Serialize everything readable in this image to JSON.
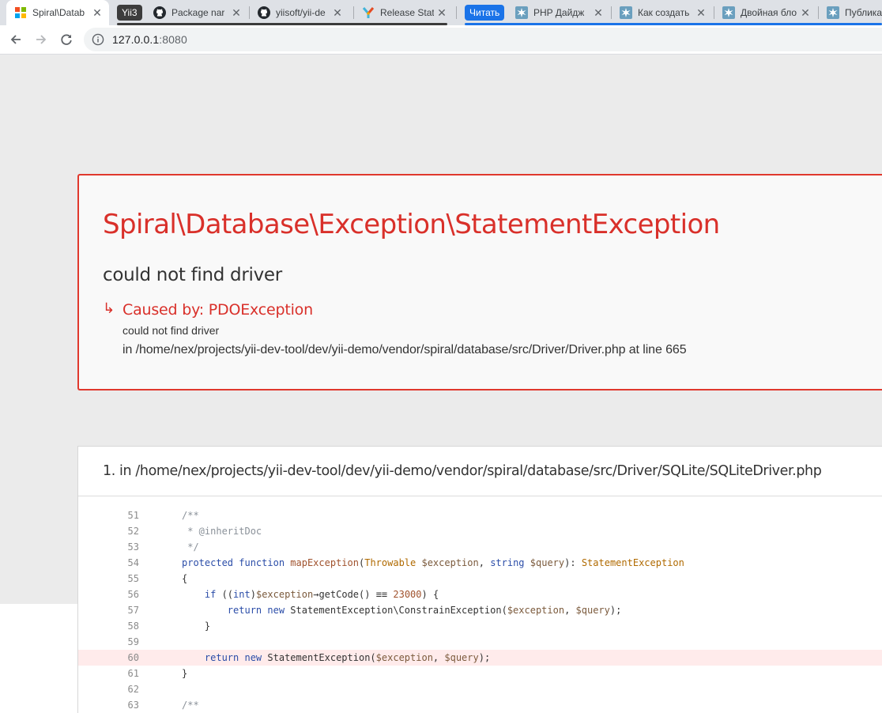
{
  "browser": {
    "tabs": [
      {
        "title": "Spiral\\Datab",
        "icon": "windows-tiles-icon",
        "active": true
      },
      {
        "title": "Package nar",
        "icon": "github-icon",
        "badge": "Yii3",
        "badge_color": "#3c3c3c"
      },
      {
        "title": "yiisoft/yii-de",
        "icon": "github-icon"
      },
      {
        "title": "Release Statu",
        "icon": "yii-logo-icon"
      },
      {
        "title": "PHP Дайдж",
        "icon": "habr-icon",
        "badge": "Читать",
        "badge_color": "#1a73e8"
      },
      {
        "title": "Как создать",
        "icon": "habr-icon"
      },
      {
        "title": "Двойная бло",
        "icon": "habr-icon"
      },
      {
        "title": "Публика",
        "icon": "habr-icon"
      }
    ],
    "address": {
      "host": "127.0.0.1",
      "port": ":8080"
    }
  },
  "exception": {
    "class": "Spiral\\Database\\Exception\\StatementException",
    "message": "could not find driver",
    "cause": {
      "label": "Caused by: PDOException",
      "message": "could not find driver",
      "location": "in /home/nex/projects/yii-dev-tool/dev/yii-demo/vendor/spiral/database/src/Driver/Driver.php at line 665"
    }
  },
  "trace": [
    {
      "title": "1. in /home/nex/projects/yii-dev-tool/dev/yii-demo/vendor/spiral/database/src/Driver/SQLite/SQLiteDriver.php",
      "highlight_line": 60,
      "lines": [
        {
          "n": "51",
          "tokens": [
            [
              "c-comment",
              "/**"
            ]
          ]
        },
        {
          "n": "52",
          "tokens": [
            [
              "c-comment",
              " * @inheritDoc"
            ]
          ]
        },
        {
          "n": "53",
          "tokens": [
            [
              "c-comment",
              " */"
            ]
          ]
        },
        {
          "n": "54",
          "tokens": [
            [
              "c-kw",
              "protected function "
            ],
            [
              "c-fn",
              "mapException"
            ],
            [
              "c-plain",
              "("
            ],
            [
              "c-type",
              "Throwable"
            ],
            [
              "c-plain",
              " "
            ],
            [
              "c-var",
              "$exception"
            ],
            [
              "c-plain",
              ", "
            ],
            [
              "c-kw",
              "string"
            ],
            [
              "c-plain",
              " "
            ],
            [
              "c-var",
              "$query"
            ],
            [
              "c-plain",
              "): "
            ],
            [
              "c-type",
              "StatementException"
            ]
          ]
        },
        {
          "n": "55",
          "tokens": [
            [
              "c-plain",
              "{"
            ]
          ]
        },
        {
          "n": "56",
          "tokens": [
            [
              "c-plain",
              "    "
            ],
            [
              "c-kw",
              "if"
            ],
            [
              "c-plain",
              " (("
            ],
            [
              "c-kw",
              "int"
            ],
            [
              "c-plain",
              ")"
            ],
            [
              "c-var",
              "$exception"
            ],
            [
              "c-plain",
              "→getCode() ≡≡ "
            ],
            [
              "c-num",
              "23000"
            ],
            [
              "c-plain",
              ") {"
            ]
          ]
        },
        {
          "n": "57",
          "tokens": [
            [
              "c-plain",
              "        "
            ],
            [
              "c-kw",
              "return new "
            ],
            [
              "c-plain",
              "StatementException\\ConstrainException("
            ],
            [
              "c-var",
              "$exception"
            ],
            [
              "c-plain",
              ", "
            ],
            [
              "c-var",
              "$query"
            ],
            [
              "c-plain",
              ");"
            ]
          ]
        },
        {
          "n": "58",
          "tokens": [
            [
              "c-plain",
              "    }"
            ]
          ]
        },
        {
          "n": "59",
          "tokens": [
            [
              "c-plain",
              ""
            ]
          ]
        },
        {
          "n": "60",
          "tokens": [
            [
              "c-plain",
              "    "
            ],
            [
              "c-kw",
              "return new "
            ],
            [
              "c-plain",
              "StatementException("
            ],
            [
              "c-var",
              "$exception"
            ],
            [
              "c-plain",
              ", "
            ],
            [
              "c-var",
              "$query"
            ],
            [
              "c-plain",
              ");"
            ]
          ]
        },
        {
          "n": "61",
          "tokens": [
            [
              "c-plain",
              "}"
            ]
          ]
        },
        {
          "n": "62",
          "tokens": [
            [
              "c-plain",
              ""
            ]
          ]
        },
        {
          "n": "63",
          "tokens": [
            [
              "c-comment",
              "/**"
            ]
          ]
        }
      ]
    }
  ],
  "colors": {
    "accent_red": "#d9302a",
    "highlight_row": "#ffebeb",
    "page_bg": "#ebebeb"
  }
}
